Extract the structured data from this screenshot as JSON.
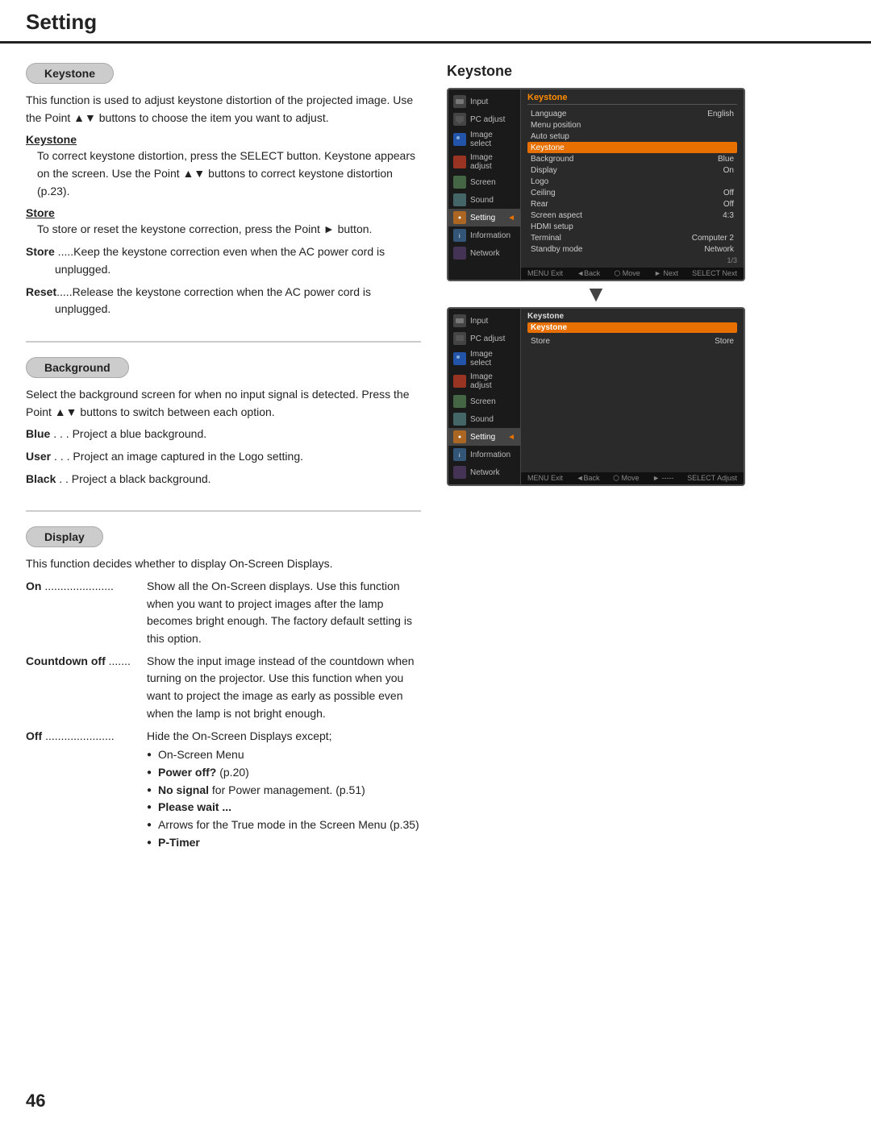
{
  "header": {
    "title": "Setting"
  },
  "page_number": "46",
  "sections": {
    "keystone": {
      "label": "Keystone",
      "intro": "This function is used to adjust keystone distortion of the projected image. Use the Point ▲▼ buttons to choose the item you want to adjust.",
      "subsections": [
        {
          "title": "Keystone",
          "text": "To correct keystone distortion, press the SELECT button. Keystone appears on the screen. Use the Point ▲▼ buttons to correct keystone distortion (p.23)."
        },
        {
          "title": "Store",
          "text": "To store or reset the keystone correction, press the Point ► button."
        }
      ],
      "store_reset": [
        {
          "term": "Store",
          "desc": "Keep the keystone correction even when the AC power cord is unplugged."
        },
        {
          "term": "Reset",
          "desc": "Release the keystone correction when the AC power cord is unplugged."
        }
      ]
    },
    "background": {
      "label": "Background",
      "intro": "Select the background screen for when no input signal is detected. Press the Point ▲▼ buttons to switch between each option.",
      "options": [
        {
          "term": "Blue",
          "desc": "Project a blue background."
        },
        {
          "term": "User",
          "desc": "Project an image captured in the Logo setting."
        },
        {
          "term": "Black",
          "desc": "Project a black background."
        }
      ]
    },
    "display": {
      "label": "Display",
      "intro": "This function decides whether to display On-Screen Displays.",
      "options": [
        {
          "term": "On",
          "dots": ".....................",
          "desc": "Show all the On-Screen displays. Use this function when you want to project images after the lamp becomes bright enough. The factory default setting is this option."
        },
        {
          "term": "Countdown off",
          "dots": ".......",
          "desc": "Show the input image instead of the countdown when turning on the projector. Use this function when you want to project the image as early as possible even when the lamp is not bright enough."
        },
        {
          "term": "Off",
          "dots": ".....................",
          "desc": "Hide the On-Screen Displays except;",
          "bullets": [
            {
              "text": "On-Screen Menu",
              "bold": false
            },
            {
              "text": "Power off?",
              "bold": true,
              "suffix": " (p.20)"
            },
            {
              "text": "No signal",
              "bold": true,
              "suffix": " for Power management. (p.51)"
            },
            {
              "text": "Please wait ...",
              "bold": true,
              "suffix": ""
            },
            {
              "text": "Arrows for the True mode in the Screen Menu (p.35)",
              "bold": false
            },
            {
              "text": "P-Timer",
              "bold": true,
              "suffix": ""
            }
          ]
        }
      ]
    }
  },
  "projector_ui": {
    "screen1": {
      "sidebar_items": [
        {
          "label": "Input",
          "icon": "ic-input",
          "active": false
        },
        {
          "label": "PC adjust",
          "icon": "ic-pcadj",
          "active": false
        },
        {
          "label": "Image select",
          "icon": "ic-imgsel",
          "active": false
        },
        {
          "label": "Image adjust",
          "icon": "ic-imgadj",
          "active": false
        },
        {
          "label": "Screen",
          "icon": "ic-screen",
          "active": false
        },
        {
          "label": "Sound",
          "icon": "ic-sound",
          "active": false
        },
        {
          "label": "Setting",
          "icon": "ic-setting",
          "active": true
        },
        {
          "label": "Information",
          "icon": "ic-info",
          "active": false
        },
        {
          "label": "Network",
          "icon": "ic-network",
          "active": false
        }
      ],
      "menu_title": "Keystone",
      "menu_items": [
        {
          "label": "Language",
          "value": "English",
          "highlighted": false
        },
        {
          "label": "Menu position",
          "value": "",
          "highlighted": false
        },
        {
          "label": "Auto setup",
          "value": "",
          "highlighted": false
        },
        {
          "label": "Keystone",
          "value": "",
          "highlighted": true
        },
        {
          "label": "Background",
          "value": "Blue",
          "highlighted": false
        },
        {
          "label": "Display",
          "value": "On",
          "highlighted": false
        },
        {
          "label": "Logo",
          "value": "",
          "highlighted": false
        },
        {
          "label": "Ceiling",
          "value": "Off",
          "highlighted": false
        },
        {
          "label": "Rear",
          "value": "Off",
          "highlighted": false
        },
        {
          "label": "Screen aspect",
          "value": "4:3",
          "highlighted": false
        },
        {
          "label": "HDMI setup",
          "value": "",
          "highlighted": false
        },
        {
          "label": "Terminal",
          "value": "Computer 2",
          "highlighted": false
        },
        {
          "label": "Standby mode",
          "value": "Network",
          "highlighted": false
        }
      ],
      "page_indicator": "1/3",
      "bottom_bar": [
        "MENU Exit",
        "◄Back",
        "⬡ Move",
        "► Next",
        "SELECT Next"
      ]
    },
    "screen2": {
      "sidebar_items": [
        {
          "label": "Input",
          "icon": "ic-input",
          "active": false
        },
        {
          "label": "PC adjust",
          "icon": "ic-pcadj",
          "active": false
        },
        {
          "label": "Image select",
          "icon": "ic-imgsel",
          "active": false
        },
        {
          "label": "Image adjust",
          "icon": "ic-imgadj",
          "active": false
        },
        {
          "label": "Screen",
          "icon": "ic-screen",
          "active": false
        },
        {
          "label": "Sound",
          "icon": "ic-sound",
          "active": false
        },
        {
          "label": "Setting",
          "icon": "ic-setting",
          "active": true
        },
        {
          "label": "Information",
          "icon": "ic-info",
          "active": false
        },
        {
          "label": "Network",
          "icon": "ic-network",
          "active": false
        }
      ],
      "sub_header": "Keystone",
      "sub_highlight": "Keystone",
      "sub_items": [
        {
          "label": "Store",
          "value": "Store"
        }
      ],
      "bottom_bar": [
        "MENU Exit",
        "◄Back",
        "⬡ Move",
        "► -----",
        "SELECT Adjust"
      ]
    }
  }
}
